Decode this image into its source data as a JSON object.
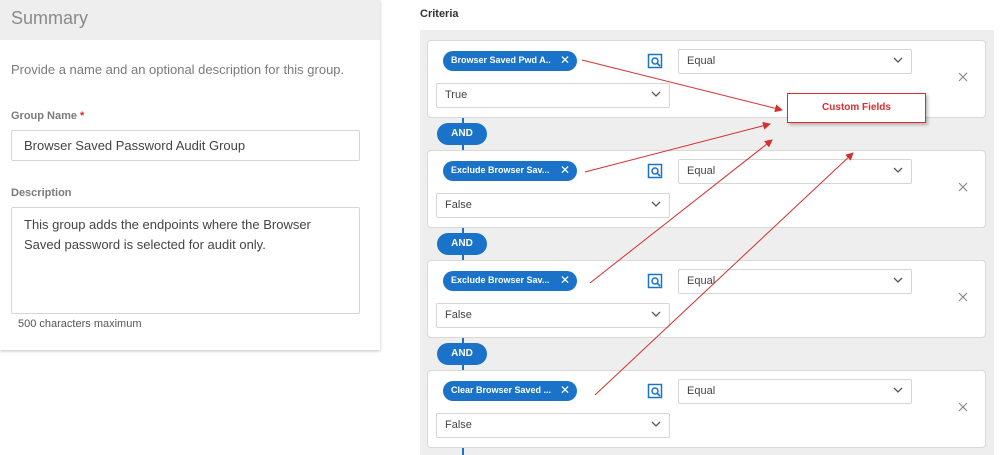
{
  "summary": {
    "title": "Summary",
    "intro": "Provide a name and an optional description for this group.",
    "group_name_label": "Group Name",
    "required_mark": "*",
    "group_name_value": "Browser Saved Password Audit Group",
    "description_label": "Description",
    "description_value": "This group adds the endpoints where the Browser Saved password is selected for audit only.",
    "char_hint": "500 characters maximum"
  },
  "criteria": {
    "label": "Criteria",
    "and_label": "AND",
    "rows": [
      {
        "field": "Browser Saved Pwd A...",
        "operator": "Equal",
        "value": "True"
      },
      {
        "field": "Exclude Browser Sav...",
        "operator": "Equal",
        "value": "False"
      },
      {
        "field": "Exclude Browser Sav...",
        "operator": "Equal",
        "value": "False"
      },
      {
        "field": "Clear Browser Saved ...",
        "operator": "Equal",
        "value": "False"
      }
    ]
  },
  "annotation": {
    "callout_text": "Custom Fields",
    "color": "#d32f2f"
  },
  "colors": {
    "accent": "#1a73c9",
    "panel_bg": "#eeeeee"
  }
}
